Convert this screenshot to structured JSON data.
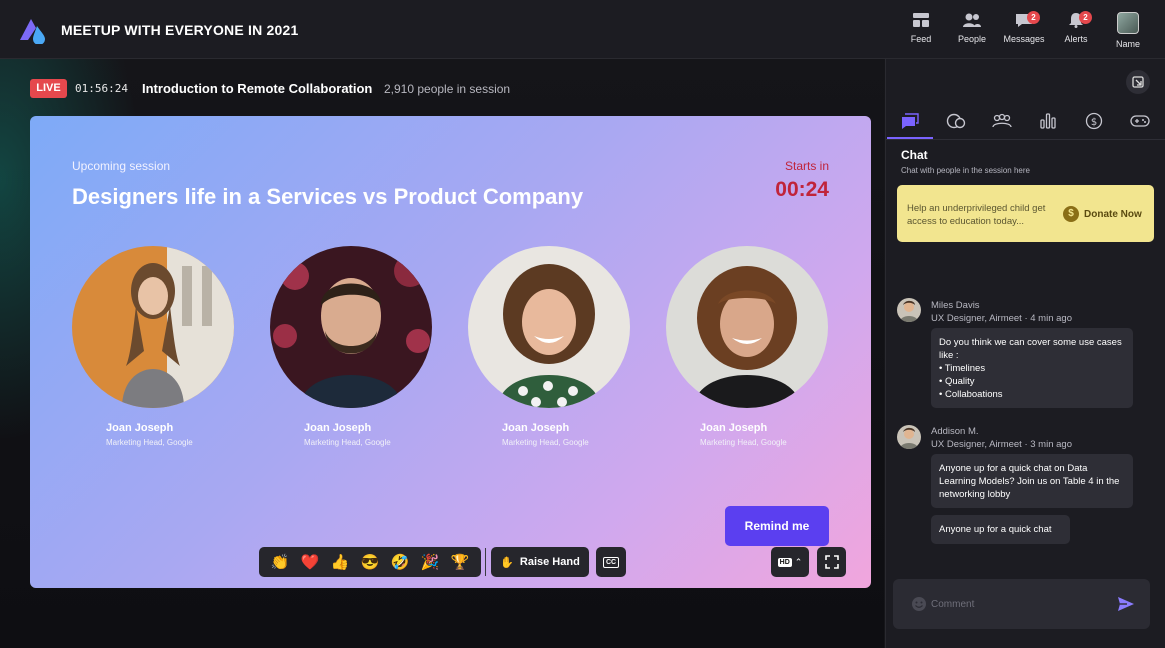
{
  "app": {
    "title": "MEETUP WITH EVERYONE IN 2021"
  },
  "nav": [
    {
      "label": "Feed",
      "icon": "feed-icon"
    },
    {
      "label": "People",
      "icon": "people-icon"
    },
    {
      "label": "Messages",
      "icon": "messages-icon",
      "badge": "2"
    },
    {
      "label": "Alerts",
      "icon": "bell-icon",
      "badge": "2"
    },
    {
      "label": "Name",
      "icon": "avatar"
    }
  ],
  "session": {
    "live_label": "LIVE",
    "timer": "01:56:24",
    "title": "Introduction to Remote Collaboration",
    "people": "2,910 people in session"
  },
  "card": {
    "upcoming_label": "Upcoming session",
    "title": "Designers life in a Services vs Product Company",
    "starts_label": "Starts in",
    "countdown": "00:24",
    "remind_label": "Remind me",
    "speakers": [
      {
        "name": "Joan Joseph",
        "role": "Marketing Head, Google"
      },
      {
        "name": "Joan Joseph",
        "role": "Marketing Head, Google"
      },
      {
        "name": "Joan Joseph",
        "role": "Marketing Head, Google"
      },
      {
        "name": "Joan Joseph",
        "role": "Marketing Head, Google"
      }
    ]
  },
  "controls": {
    "reactions": [
      "👏",
      "❤️",
      "👍",
      "😎",
      "🤣",
      "🎉",
      "🏆"
    ],
    "raise_hand": "Raise Hand",
    "cc": "CC",
    "hd": "HD"
  },
  "panel": {
    "tabs": [
      "chat-icon",
      "qa-icon",
      "people-icon",
      "polls-icon",
      "dollar-icon",
      "gamepad-icon"
    ],
    "chat_title": "Chat",
    "chat_subtitle": "Chat with people in the session here",
    "donate": {
      "text": "Help an underprivileged child get access to education today...",
      "button": "Donate Now",
      "icon": "$"
    },
    "messages": [
      {
        "name": "Miles Davis",
        "meta": "UX Designer, Airmeet · 4 min ago",
        "bubbles": [
          "Do you think we can cover some use cases like :\n• Timelines\n• Quality\n• Collaboations"
        ]
      },
      {
        "name": "Addison M.",
        "meta": "UX Designer, Airmeet · 3 min ago",
        "bubbles": [
          "Anyone up for a quick chat on Data Learning Models? Join us on Table 4 in the networking lobby",
          "Anyone up for a quick chat"
        ]
      }
    ],
    "comment_placeholder": "Comment"
  },
  "colors": {
    "accent": "#5b3ff0",
    "live": "#e5484d",
    "countdown": "#c0243a",
    "donate_bg": "#f2e58f"
  }
}
